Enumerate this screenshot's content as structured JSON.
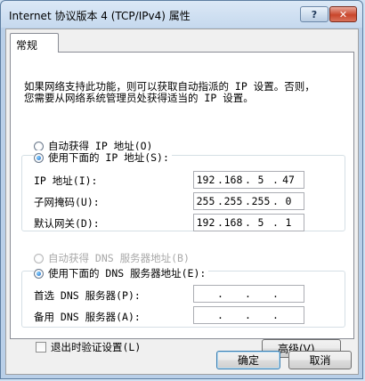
{
  "window": {
    "title": "Internet 协议版本 4 (TCP/IPv4) 属性",
    "help_label": "?",
    "close_label": "✕"
  },
  "tabs": [
    {
      "label": "常规"
    }
  ],
  "description": [
    "如果网络支持此功能，则可以获取自动指派的 IP 设置。否则，",
    "您需要从网络系统管理员处获得适当的 IP 设置。"
  ],
  "ip_section": {
    "auto_label": "自动获得 IP 地址(O)",
    "manual_label": "使用下面的 IP 地址(S):",
    "selected": "manual",
    "fields": [
      {
        "label": "IP 地址(I):",
        "octets": [
          "192",
          "168",
          "5",
          "47"
        ]
      },
      {
        "label": "子网掩码(U):",
        "octets": [
          "255",
          "255",
          "255",
          "0"
        ]
      },
      {
        "label": "默认网关(D):",
        "octets": [
          "192",
          "168",
          "5",
          "1"
        ]
      }
    ]
  },
  "dns_section": {
    "auto_label": "自动获得 DNS 服务器地址(B)",
    "manual_label": "使用下面的 DNS 服务器地址(E):",
    "selected": "manual",
    "fields": [
      {
        "label": "首选 DNS 服务器(P):",
        "octets": [
          "",
          "",
          "",
          ""
        ]
      },
      {
        "label": "备用 DNS 服务器(A):",
        "octets": [
          "",
          "",
          "",
          ""
        ]
      }
    ]
  },
  "validate_on_exit": {
    "label": "退出时验证设置(L)",
    "checked": false
  },
  "advanced_label": "高级(V)...",
  "ok_label": "确定",
  "cancel_label": "取消"
}
